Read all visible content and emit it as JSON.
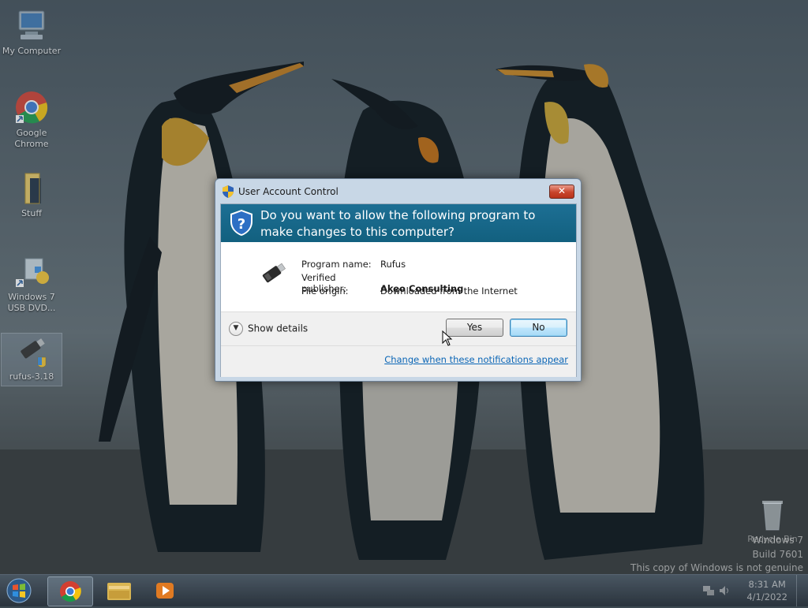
{
  "desktop": {
    "icons": [
      {
        "label": "My Computer",
        "icon": "computer-icon"
      },
      {
        "label": "Google Chrome",
        "icon": "chrome-icon"
      },
      {
        "label": "Stuff",
        "icon": "folder-icon"
      },
      {
        "label": "Windows 7 USB DVD...",
        "icon": "windows-usb-tool-icon"
      },
      {
        "label": "rufus-3.18",
        "icon": "usb-drive-icon"
      }
    ],
    "recycle_bin": "Recycle Bin",
    "watermark": {
      "line1": "Windows 7",
      "line2": "Build 7601",
      "line3": "This copy of Windows is not genuine"
    }
  },
  "uac": {
    "title": "User Account Control",
    "close_label": "✕",
    "question": "Do you want to allow the following program to make changes to this computer?",
    "program_name_label": "Program name:",
    "program_name": "Rufus",
    "publisher_label": "Verified publisher:",
    "publisher": "Akeo Consulting",
    "origin_label": "File origin:",
    "origin": "Downloaded from the Internet",
    "show_details": "Show details",
    "yes": "Yes",
    "no": "No",
    "change_link": "Change when these notifications appear"
  },
  "taskbar": {
    "items": [
      "start-orb",
      "chrome",
      "windows-explorer",
      "media-player"
    ],
    "time": "8:31 AM",
    "date": "4/1/2022"
  },
  "colors": {
    "uac_header": "#15668a",
    "link": "#0b66b6"
  }
}
